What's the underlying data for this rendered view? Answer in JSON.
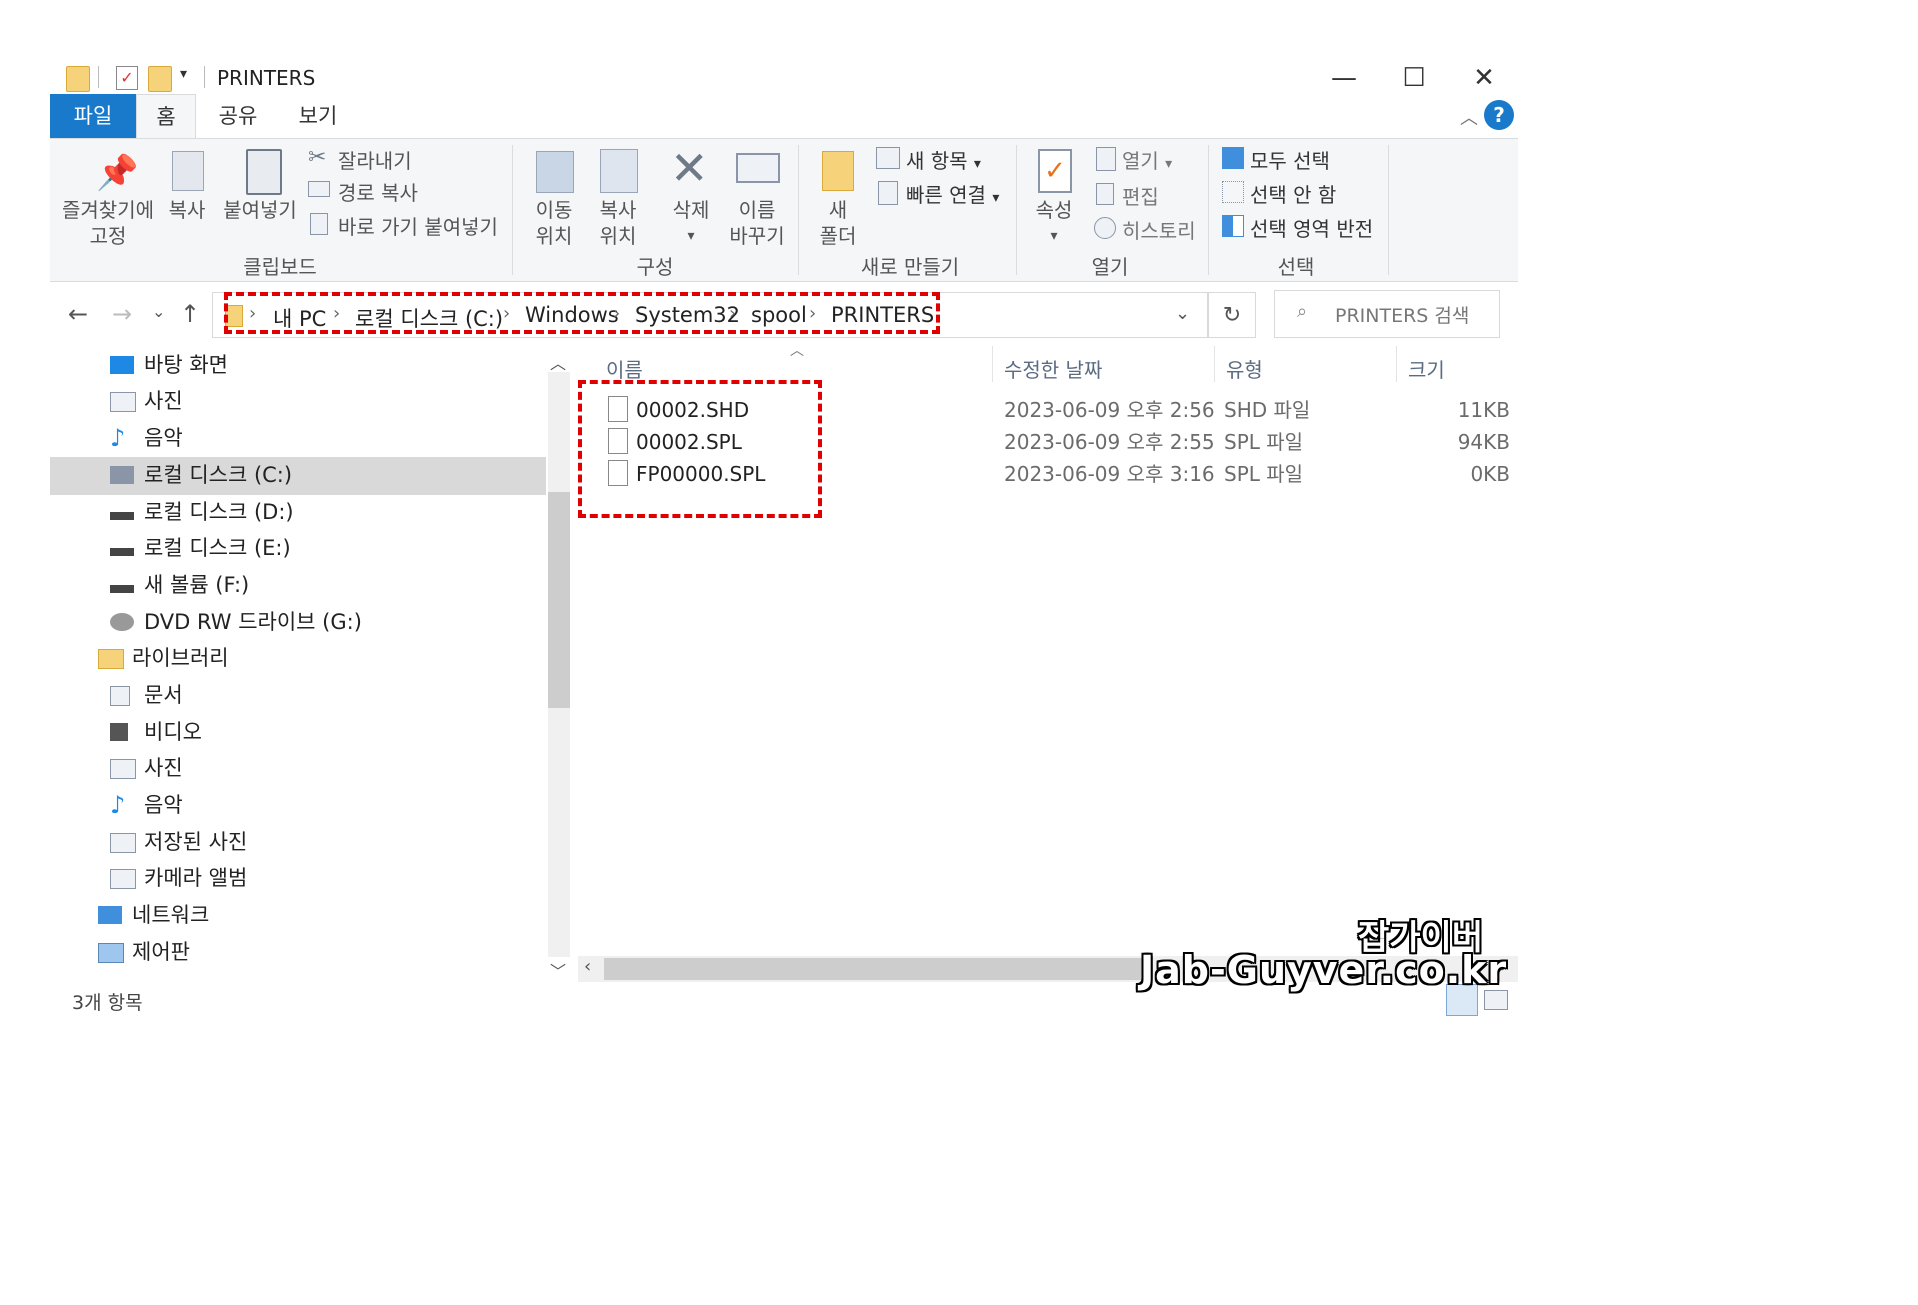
{
  "window": {
    "title": "PRINTERS"
  },
  "ribbon_tabs": [
    "파일",
    "홈",
    "공유",
    "보기"
  ],
  "ribbon": {
    "clipboard": {
      "pin_line1": "즐겨찾기에",
      "pin_line2": "고정",
      "copy": "복사",
      "paste": "붙여넣기",
      "cut": "잘라내기",
      "copy_path": "경로 복사",
      "paste_shortcut": "바로 가기 붙여넣기",
      "group": "클립보드"
    },
    "organize": {
      "move_line1": "이동",
      "move_line2": "위치",
      "copyto_line1": "복사",
      "copyto_line2": "위치",
      "delete": "삭제",
      "rename_line1": "이름",
      "rename_line2": "바꾸기",
      "group": "구성"
    },
    "new": {
      "folder_line1": "새",
      "folder_line2": "폴더",
      "new_item": "새 항목",
      "easy_access": "빠른 연결",
      "group": "새로 만들기"
    },
    "open": {
      "properties": "속성",
      "open": "열기",
      "edit": "편집",
      "history": "히스토리",
      "group": "열기"
    },
    "select": {
      "select_all": "모두 선택",
      "select_none": "선택 안 함",
      "invert": "선택 영역 반전",
      "group": "선택"
    }
  },
  "breadcrumb": [
    "내 PC",
    "로컬 디스크 (C:)",
    "Windows",
    "System32",
    "spool",
    "PRINTERS"
  ],
  "search_placeholder": "PRINTERS 검색",
  "nav_items": [
    {
      "label": "바탕 화면",
      "icon": "desktop-icon"
    },
    {
      "label": "사진",
      "icon": "pictures-icon"
    },
    {
      "label": "음악",
      "icon": "music-icon"
    },
    {
      "label": "로컬 디스크 (C:)",
      "icon": "system-drive-icon"
    },
    {
      "label": "로컬 디스크 (D:)",
      "icon": "drive-icon"
    },
    {
      "label": "로컬 디스크 (E:)",
      "icon": "drive-icon"
    },
    {
      "label": "새 볼륨 (F:)",
      "icon": "drive-icon"
    },
    {
      "label": "DVD RW 드라이브 (G:)",
      "icon": "dvd-drive-icon"
    },
    {
      "label": "라이브러리",
      "icon": "library-icon"
    },
    {
      "label": "문서",
      "icon": "documents-icon"
    },
    {
      "label": "비디오",
      "icon": "videos-icon"
    },
    {
      "label": "사진",
      "icon": "pictures-icon"
    },
    {
      "label": "음악",
      "icon": "music-icon"
    },
    {
      "label": "저장된 사진",
      "icon": "pictures-icon"
    },
    {
      "label": "카메라 앨범",
      "icon": "pictures-icon"
    },
    {
      "label": "네트워크",
      "icon": "network-icon"
    },
    {
      "label": "제어판",
      "icon": "control-panel-icon"
    }
  ],
  "columns": {
    "name": "이름",
    "date": "수정한 날짜",
    "type": "유형",
    "size": "크기"
  },
  "files": [
    {
      "name": "00002.SHD",
      "date": "2023-06-09 오후 2:56",
      "type": "SHD 파일",
      "size": "11KB"
    },
    {
      "name": "00002.SPL",
      "date": "2023-06-09 오후 2:55",
      "type": "SPL 파일",
      "size": "94KB"
    },
    {
      "name": "FP00000.SPL",
      "date": "2023-06-09 오후 3:16",
      "type": "SPL 파일",
      "size": "0KB"
    }
  ],
  "status": {
    "item_count": "3개 항목"
  },
  "watermark": {
    "line1": "잡가이버",
    "line2": "Jab-Guyver.co.kr"
  },
  "colors": {
    "accent": "#1979ca",
    "highlight_box": "#e00000",
    "selection": "#d9d9d9"
  }
}
